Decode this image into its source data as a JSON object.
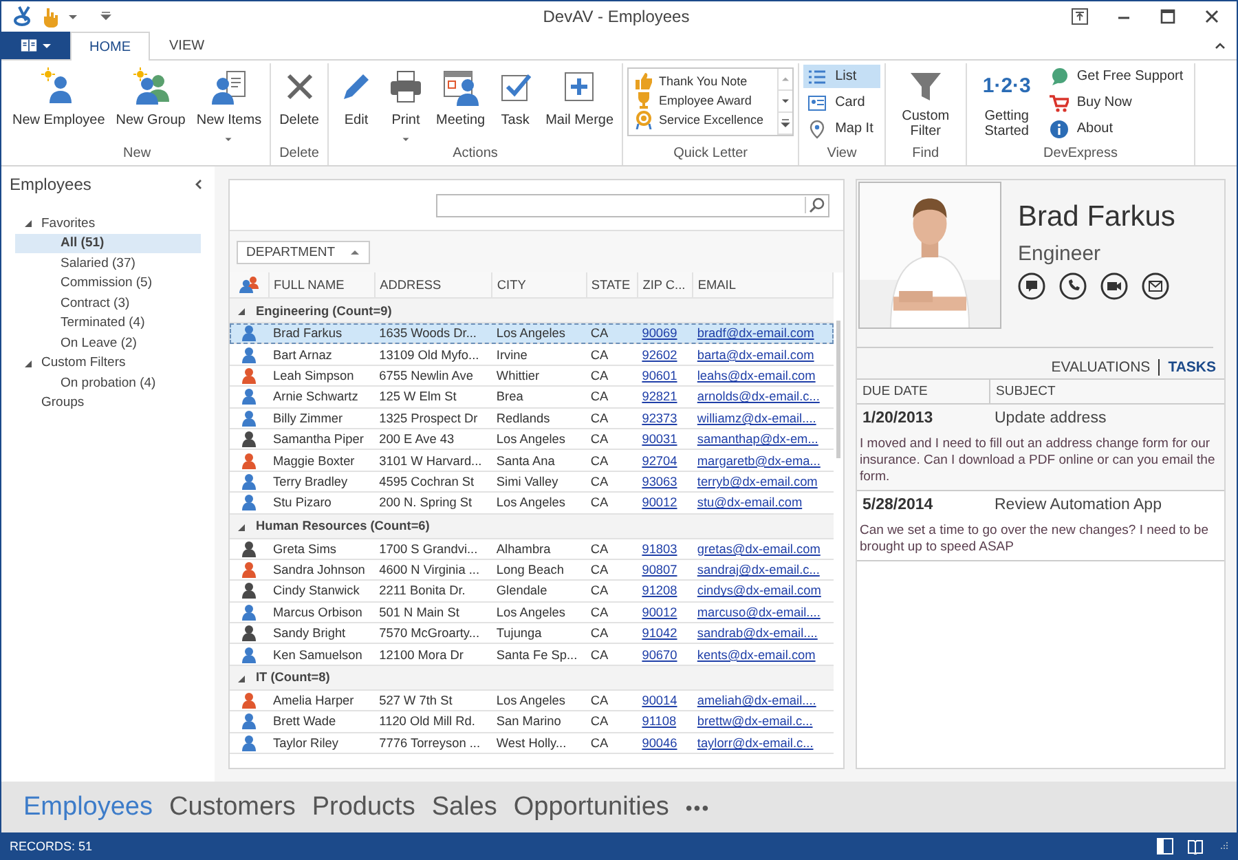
{
  "window": {
    "title": "DevAV - Employees"
  },
  "ribbon": {
    "tabs": [
      {
        "label": "HOME",
        "selected": true
      },
      {
        "label": "VIEW",
        "selected": false
      }
    ],
    "groups": [
      {
        "label": "New",
        "buttons": [
          {
            "label": "New Employee"
          },
          {
            "label": "New Group"
          },
          {
            "label": "New Items",
            "dropdown": true
          }
        ]
      },
      {
        "label": "Delete",
        "buttons": [
          {
            "label": "Delete"
          }
        ]
      },
      {
        "label": "Actions",
        "buttons": [
          {
            "label": "Edit"
          },
          {
            "label": "Print",
            "dropdown": true
          },
          {
            "label": "Meeting"
          },
          {
            "label": "Task"
          },
          {
            "label": "Mail Merge"
          }
        ]
      },
      {
        "label": "Quick Letter",
        "gallery": [
          "Thank You Note",
          "Employee Award",
          "Service Excellence"
        ]
      },
      {
        "label": "View",
        "small_buttons": [
          {
            "label": "List",
            "selected": true
          },
          {
            "label": "Card",
            "selected": false
          },
          {
            "label": "Map It",
            "selected": false
          }
        ]
      },
      {
        "label": "Find",
        "buttons": [
          {
            "label": "Custom Filter"
          }
        ]
      },
      {
        "label": "DevExpress",
        "buttons": [
          {
            "label": "Getting Started",
            "icon_text": "1·2·3"
          }
        ],
        "small_buttons": [
          {
            "label": "Get Free Support"
          },
          {
            "label": "Buy Now"
          },
          {
            "label": "About"
          }
        ]
      }
    ]
  },
  "sidebar": {
    "title": "Employees",
    "tree": [
      {
        "label": "Favorites",
        "expanded": true,
        "children": [
          {
            "label": "All (51)",
            "selected": true
          },
          {
            "label": "Salaried (37)",
            "selected": false
          },
          {
            "label": "Commission (5)",
            "selected": false
          },
          {
            "label": "Contract (3)",
            "selected": false
          },
          {
            "label": "Terminated (4)",
            "selected": false
          },
          {
            "label": "On Leave (2)",
            "selected": false
          }
        ]
      },
      {
        "label": "Custom Filters",
        "expanded": true,
        "children": [
          {
            "label": "On probation (4)",
            "selected": false
          }
        ]
      },
      {
        "label": "Groups"
      }
    ]
  },
  "grid": {
    "group_by": "DEPARTMENT",
    "columns": [
      "FULL NAME",
      "ADDRESS",
      "CITY",
      "STATE",
      "ZIP C...",
      "EMAIL"
    ],
    "groups": [
      {
        "label": "Engineering (Count=9)",
        "expanded": true,
        "rows": [
          {
            "name": "Brad Farkus",
            "address": "1635 Woods Dr...",
            "city": "Los Angeles",
            "state": "CA",
            "zip": "90069",
            "email": "bradf@dx-email.com",
            "color": "#3d7cc9",
            "selected": true
          },
          {
            "name": "Bart Arnaz",
            "address": "13109 Old Myfo...",
            "city": "Irvine",
            "state": "CA",
            "zip": "92602",
            "email": "barta@dx-email.com",
            "color": "#3d7cc9",
            "selected": false
          },
          {
            "name": "Leah Simpson",
            "address": "6755 Newlin Ave",
            "city": "Whittier",
            "state": "CA",
            "zip": "90601",
            "email": "leahs@dx-email.com",
            "color": "#e0582f",
            "selected": false
          },
          {
            "name": "Arnie Schwartz",
            "address": "125 W Elm St",
            "city": "Brea",
            "state": "CA",
            "zip": "92821",
            "email": "arnolds@dx-email.c...",
            "color": "#3d7cc9",
            "selected": false
          },
          {
            "name": "Billy Zimmer",
            "address": "1325 Prospect Dr",
            "city": "Redlands",
            "state": "CA",
            "zip": "92373",
            "email": "williamz@dx-email....",
            "color": "#3d7cc9",
            "selected": false
          },
          {
            "name": "Samantha Piper",
            "address": "200 E Ave 43",
            "city": "Los Angeles",
            "state": "CA",
            "zip": "90031",
            "email": "samanthap@dx-em...",
            "color": "#4a4a4a",
            "selected": false
          },
          {
            "name": "Maggie Boxter",
            "address": "3101 W Harvard...",
            "city": "Santa Ana",
            "state": "CA",
            "zip": "92704",
            "email": "margaretb@dx-ema...",
            "color": "#e0582f",
            "selected": false
          },
          {
            "name": "Terry Bradley",
            "address": "4595 Cochran St",
            "city": "Simi Valley",
            "state": "CA",
            "zip": "93063",
            "email": "terryb@dx-email.com",
            "color": "#3d7cc9",
            "selected": false
          },
          {
            "name": "Stu Pizaro",
            "address": "200 N. Spring St",
            "city": "Los Angeles",
            "state": "CA",
            "zip": "90012",
            "email": "stu@dx-email.com",
            "color": "#3d7cc9",
            "selected": false
          }
        ]
      },
      {
        "label": "Human Resources (Count=6)",
        "expanded": true,
        "rows": [
          {
            "name": "Greta Sims",
            "address": "1700 S Grandvi...",
            "city": "Alhambra",
            "state": "CA",
            "zip": "91803",
            "email": "gretas@dx-email.com",
            "color": "#4a4a4a",
            "selected": false
          },
          {
            "name": "Sandra Johnson",
            "address": "4600 N Virginia ...",
            "city": "Long Beach",
            "state": "CA",
            "zip": "90807",
            "email": "sandraj@dx-email.c...",
            "color": "#e0582f",
            "selected": false
          },
          {
            "name": "Cindy Stanwick",
            "address": "2211 Bonita Dr.",
            "city": "Glendale",
            "state": "CA",
            "zip": "91208",
            "email": "cindys@dx-email.com",
            "color": "#4a4a4a",
            "selected": false
          },
          {
            "name": "Marcus Orbison",
            "address": "501 N Main St",
            "city": "Los Angeles",
            "state": "CA",
            "zip": "90012",
            "email": "marcuso@dx-email....",
            "color": "#3d7cc9",
            "selected": false
          },
          {
            "name": "Sandy Bright",
            "address": "7570 McGroarty...",
            "city": "Tujunga",
            "state": "CA",
            "zip": "91042",
            "email": "sandrab@dx-email....",
            "color": "#4a4a4a",
            "selected": false
          },
          {
            "name": "Ken Samuelson",
            "address": "12100 Mora Dr",
            "city": "Santa Fe Sp...",
            "state": "CA",
            "zip": "90670",
            "email": "kents@dx-email.com",
            "color": "#3d7cc9",
            "selected": false
          }
        ]
      },
      {
        "label": "IT (Count=8)",
        "expanded": true,
        "rows": [
          {
            "name": "Amelia Harper",
            "address": "527 W 7th St",
            "city": "Los Angeles",
            "state": "CA",
            "zip": "90014",
            "email": "ameliah@dx-email....",
            "color": "#e0582f",
            "selected": false
          },
          {
            "name": "Brett Wade",
            "address": "1120 Old Mill Rd.",
            "city": "San Marino",
            "state": "CA",
            "zip": "91108",
            "email": "brettw@dx-email.c...",
            "color": "#3d7cc9",
            "selected": false
          },
          {
            "name": "Taylor Riley",
            "address": "7776 Torreyson ...",
            "city": "West Holly...",
            "state": "CA",
            "zip": "90046",
            "email": "taylorr@dx-email.c...",
            "color": "#3d7cc9",
            "selected": false
          }
        ]
      }
    ]
  },
  "details": {
    "name": "Brad Farkus",
    "title": "Engineer",
    "tabs": [
      {
        "label": "EVALUATIONS",
        "selected": false
      },
      {
        "label": "TASKS",
        "selected": true
      }
    ],
    "task_columns": [
      "DUE DATE",
      "SUBJECT"
    ],
    "tasks": [
      {
        "due": "1/20/2013",
        "subject": "Update address",
        "description": "I moved and I need to fill out an address change form for our insurance.  Can I download a PDF online or can you email the form."
      },
      {
        "due": "5/28/2014",
        "subject": "Review Automation App",
        "description": "Can we set a time to go over the new changes?  I need to be brought up to speed ASAP"
      }
    ]
  },
  "navigation": {
    "items": [
      {
        "label": "Employees",
        "selected": true
      },
      {
        "label": "Customers",
        "selected": false
      },
      {
        "label": "Products",
        "selected": false
      },
      {
        "label": "Sales",
        "selected": false
      },
      {
        "label": "Opportunities",
        "selected": false
      }
    ],
    "more": "•••"
  },
  "status_bar": {
    "records": "RECORDS: 51"
  }
}
